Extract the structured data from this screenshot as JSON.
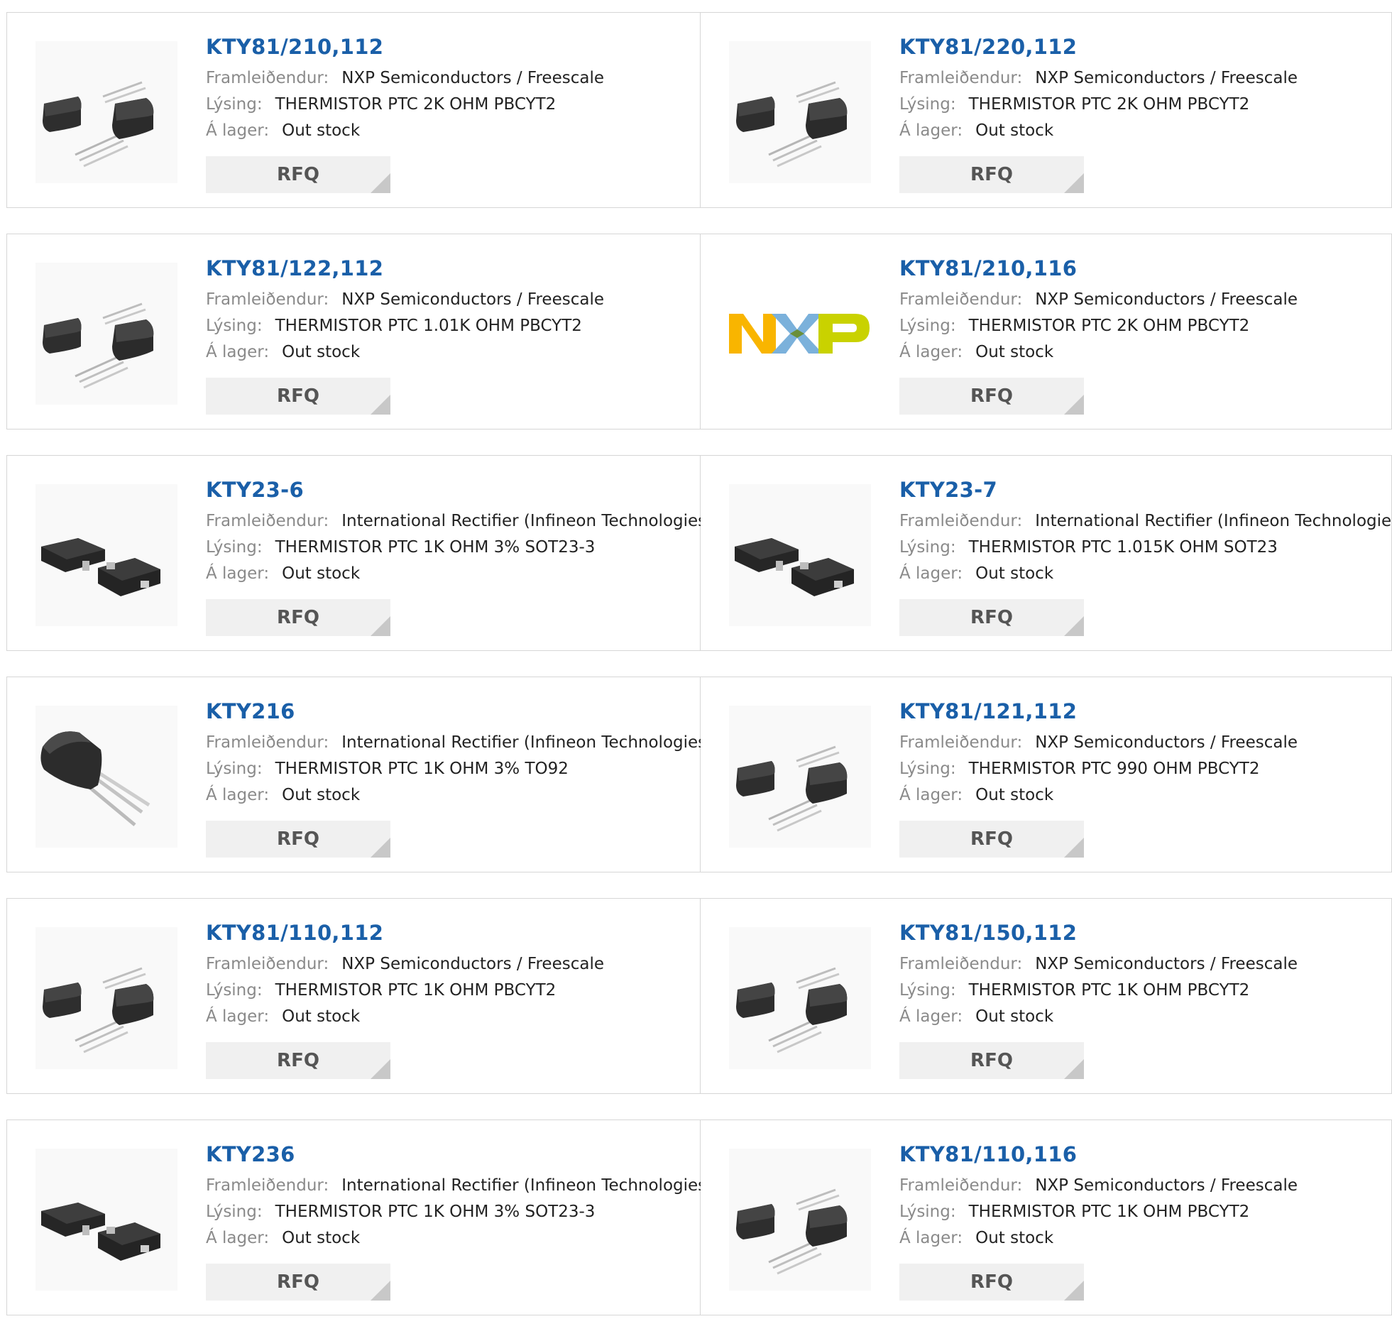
{
  "labels": {
    "manufacturer": "Framleiðendur:",
    "description": "Lýsing:",
    "stock": "Á lager:",
    "rfq": "RFQ"
  },
  "products": [
    {
      "part": "KTY81/210,112",
      "manufacturer": "NXP Semiconductors / Freescale",
      "description": "THERMISTOR PTC 2K OHM PBCYT2",
      "stock": "Out stock",
      "image": "to92-two-parts"
    },
    {
      "part": "KTY81/220,112",
      "manufacturer": "NXP Semiconductors / Freescale",
      "description": "THERMISTOR PTC 2K OHM PBCYT2",
      "stock": "Out stock",
      "image": "to92-two-parts"
    },
    {
      "part": "KTY81/122,112",
      "manufacturer": "NXP Semiconductors / Freescale",
      "description": "THERMISTOR PTC 1.01K OHM PBCYT2",
      "stock": "Out stock",
      "image": "to92-two-parts"
    },
    {
      "part": "KTY81/210,116",
      "manufacturer": "NXP Semiconductors / Freescale",
      "description": "THERMISTOR PTC 2K OHM PBCYT2",
      "stock": "Out stock",
      "image": "nxp-logo",
      "logo_text": "NXP"
    },
    {
      "part": "KTY23-6",
      "manufacturer": "International Rectifier (Infineon Technologies)",
      "description": "THERMISTOR PTC 1K OHM 3% SOT23-3",
      "stock": "Out stock",
      "image": "sot23-two-parts"
    },
    {
      "part": "KTY23-7",
      "manufacturer": "International Rectifier (Infineon Technologies)",
      "description": "THERMISTOR PTC 1.015K OHM SOT23",
      "stock": "Out stock",
      "image": "sot23-two-parts"
    },
    {
      "part": "KTY216",
      "manufacturer": "International Rectifier (Infineon Technologies)",
      "description": "THERMISTOR PTC 1K OHM 3% TO92",
      "stock": "Out stock",
      "image": "to92-single"
    },
    {
      "part": "KTY81/121,112",
      "manufacturer": "NXP Semiconductors / Freescale",
      "description": "THERMISTOR PTC 990 OHM PBCYT2",
      "stock": "Out stock",
      "image": "to92-two-parts"
    },
    {
      "part": "KTY81/110,112",
      "manufacturer": "NXP Semiconductors / Freescale",
      "description": "THERMISTOR PTC 1K OHM PBCYT2",
      "stock": "Out stock",
      "image": "to92-two-parts"
    },
    {
      "part": "KTY81/150,112",
      "manufacturer": "NXP Semiconductors / Freescale",
      "description": "THERMISTOR PTC 1K OHM PBCYT2",
      "stock": "Out stock",
      "image": "to92-two-parts"
    },
    {
      "part": "KTY236",
      "manufacturer": "International Rectifier (Infineon Technologies)",
      "description": "THERMISTOR PTC 1K OHM 3% SOT23-3",
      "stock": "Out stock",
      "image": "sot23-two-parts"
    },
    {
      "part": "KTY81/110,116",
      "manufacturer": "NXP Semiconductors / Freescale",
      "description": "THERMISTOR PTC 1K OHM PBCYT2",
      "stock": "Out stock",
      "image": "to92-two-parts"
    }
  ],
  "colors": {
    "link": "#1a5fa8",
    "label": "#8a8a8a",
    "text": "#222222",
    "border": "#d6d6d6",
    "button_bg": "#f0f0f0",
    "button_text": "#555555",
    "nxp_yellow": "#f9b500",
    "nxp_blue": "#7bb1db",
    "nxp_green": "#c9d200"
  }
}
